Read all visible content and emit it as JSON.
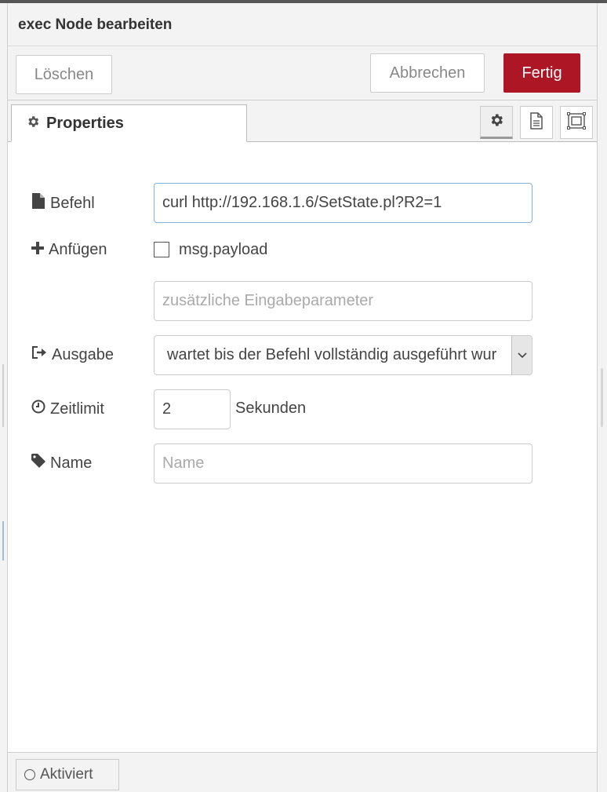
{
  "tray": {
    "title": "exec Node bearbeiten",
    "delete_label": "Löschen",
    "cancel_label": "Abbrechen",
    "done_label": "Fertig"
  },
  "tabs": {
    "properties_label": "Properties",
    "icons": [
      "gear-icon",
      "description-icon",
      "appearance-icon"
    ]
  },
  "form": {
    "command": {
      "label": "Befehl",
      "value": "curl http://192.168.1.6/SetState.pl?R2=1"
    },
    "append": {
      "label": "Anfügen",
      "checkbox_label": "msg.payload",
      "checked": false
    },
    "args": {
      "placeholder": "zusätzliche Eingabeparameter"
    },
    "output": {
      "label": "Ausgabe",
      "selected": "wartet bis der Befehl vollständig ausgeführt wur"
    },
    "timeout": {
      "label": "Zeitlimit",
      "value": "2",
      "unit": "Sekunden"
    },
    "name": {
      "label": "Name",
      "placeholder": "Name"
    }
  },
  "footer": {
    "enabled_label": "Aktiviert"
  },
  "colors": {
    "primary": "#ad1625",
    "focus_border": "#85b4dc"
  }
}
